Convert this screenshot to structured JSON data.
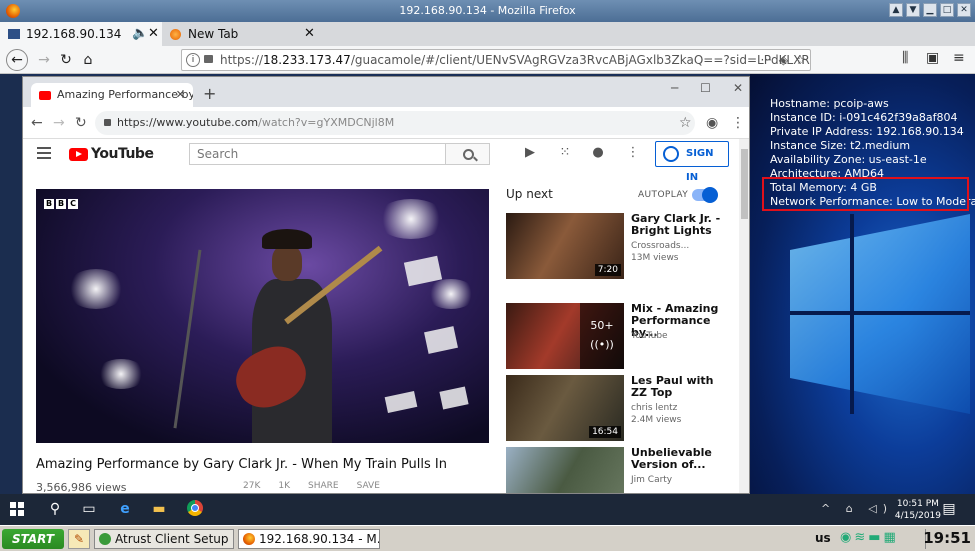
{
  "firefox": {
    "title": "192.168.90.134 - Mozilla Firefox",
    "tabs": [
      {
        "label": "192.168.90.134"
      },
      {
        "label": "New Tab"
      }
    ],
    "url_prefix": "https://",
    "url_host": "18.233.173.47",
    "url_rest": "/guacamole/#/client/UENvSVAgRGVza3RvcABjAGxlb3ZkaQ==?sid=LPdKLXR",
    "url_more": "···"
  },
  "chrome": {
    "tab_title": "Amazing Performance by Ga",
    "url_host": "https://www.youtube.com",
    "url_path": "/watch?v=gYXMDCNjl8M"
  },
  "youtube": {
    "logo_text": "YouTube",
    "search_placeholder": "Search",
    "sign_in": "SIGN IN",
    "video_title": "Amazing Performance by Gary Clark Jr. - When My Train Pulls In",
    "views": "3,566,986 views",
    "actions": [
      "27K",
      "1K",
      "SHARE",
      "SAVE"
    ],
    "up_next": "Up next",
    "autoplay": "AUTOPLAY",
    "recommendations": [
      {
        "title": "Gary Clark Jr. - Bright Lights",
        "channel": "Crossroads...",
        "views": "13M views",
        "duration": "7:20"
      },
      {
        "title": "Mix - Amazing Performance by...",
        "channel": "YouTube",
        "views": "",
        "overlay": "50+"
      },
      {
        "title": "Les Paul with ZZ Top",
        "channel": "chris lentz",
        "views": "2.4M views",
        "duration": "16:54"
      },
      {
        "title": "Unbelievable Version of...",
        "channel": "Jim Carty",
        "views": ""
      }
    ]
  },
  "sysinfo": {
    "hostname": "Hostname: pcoip-aws",
    "instance_id": "Instance ID: i-091c462f39a8af804",
    "private_ip": "Private IP Address: 192.168.90.134",
    "instance_size": "Instance Size: t2.medium",
    "availability_zone": "Availability Zone: us-east-1e",
    "architecture": "Architecture: AMD64",
    "total_memory": "Total Memory: 4 GB",
    "network_performance": "Network Performance: Low to Moderate"
  },
  "windows_taskbar": {
    "time": "10:51 PM",
    "date": "4/15/2019"
  },
  "local_taskbar": {
    "start": "START",
    "tasks": [
      {
        "label": "Atrust Client Setup"
      },
      {
        "label": "192.168.90.134 - M..."
      }
    ],
    "lang": "us",
    "clock": "19:51"
  }
}
